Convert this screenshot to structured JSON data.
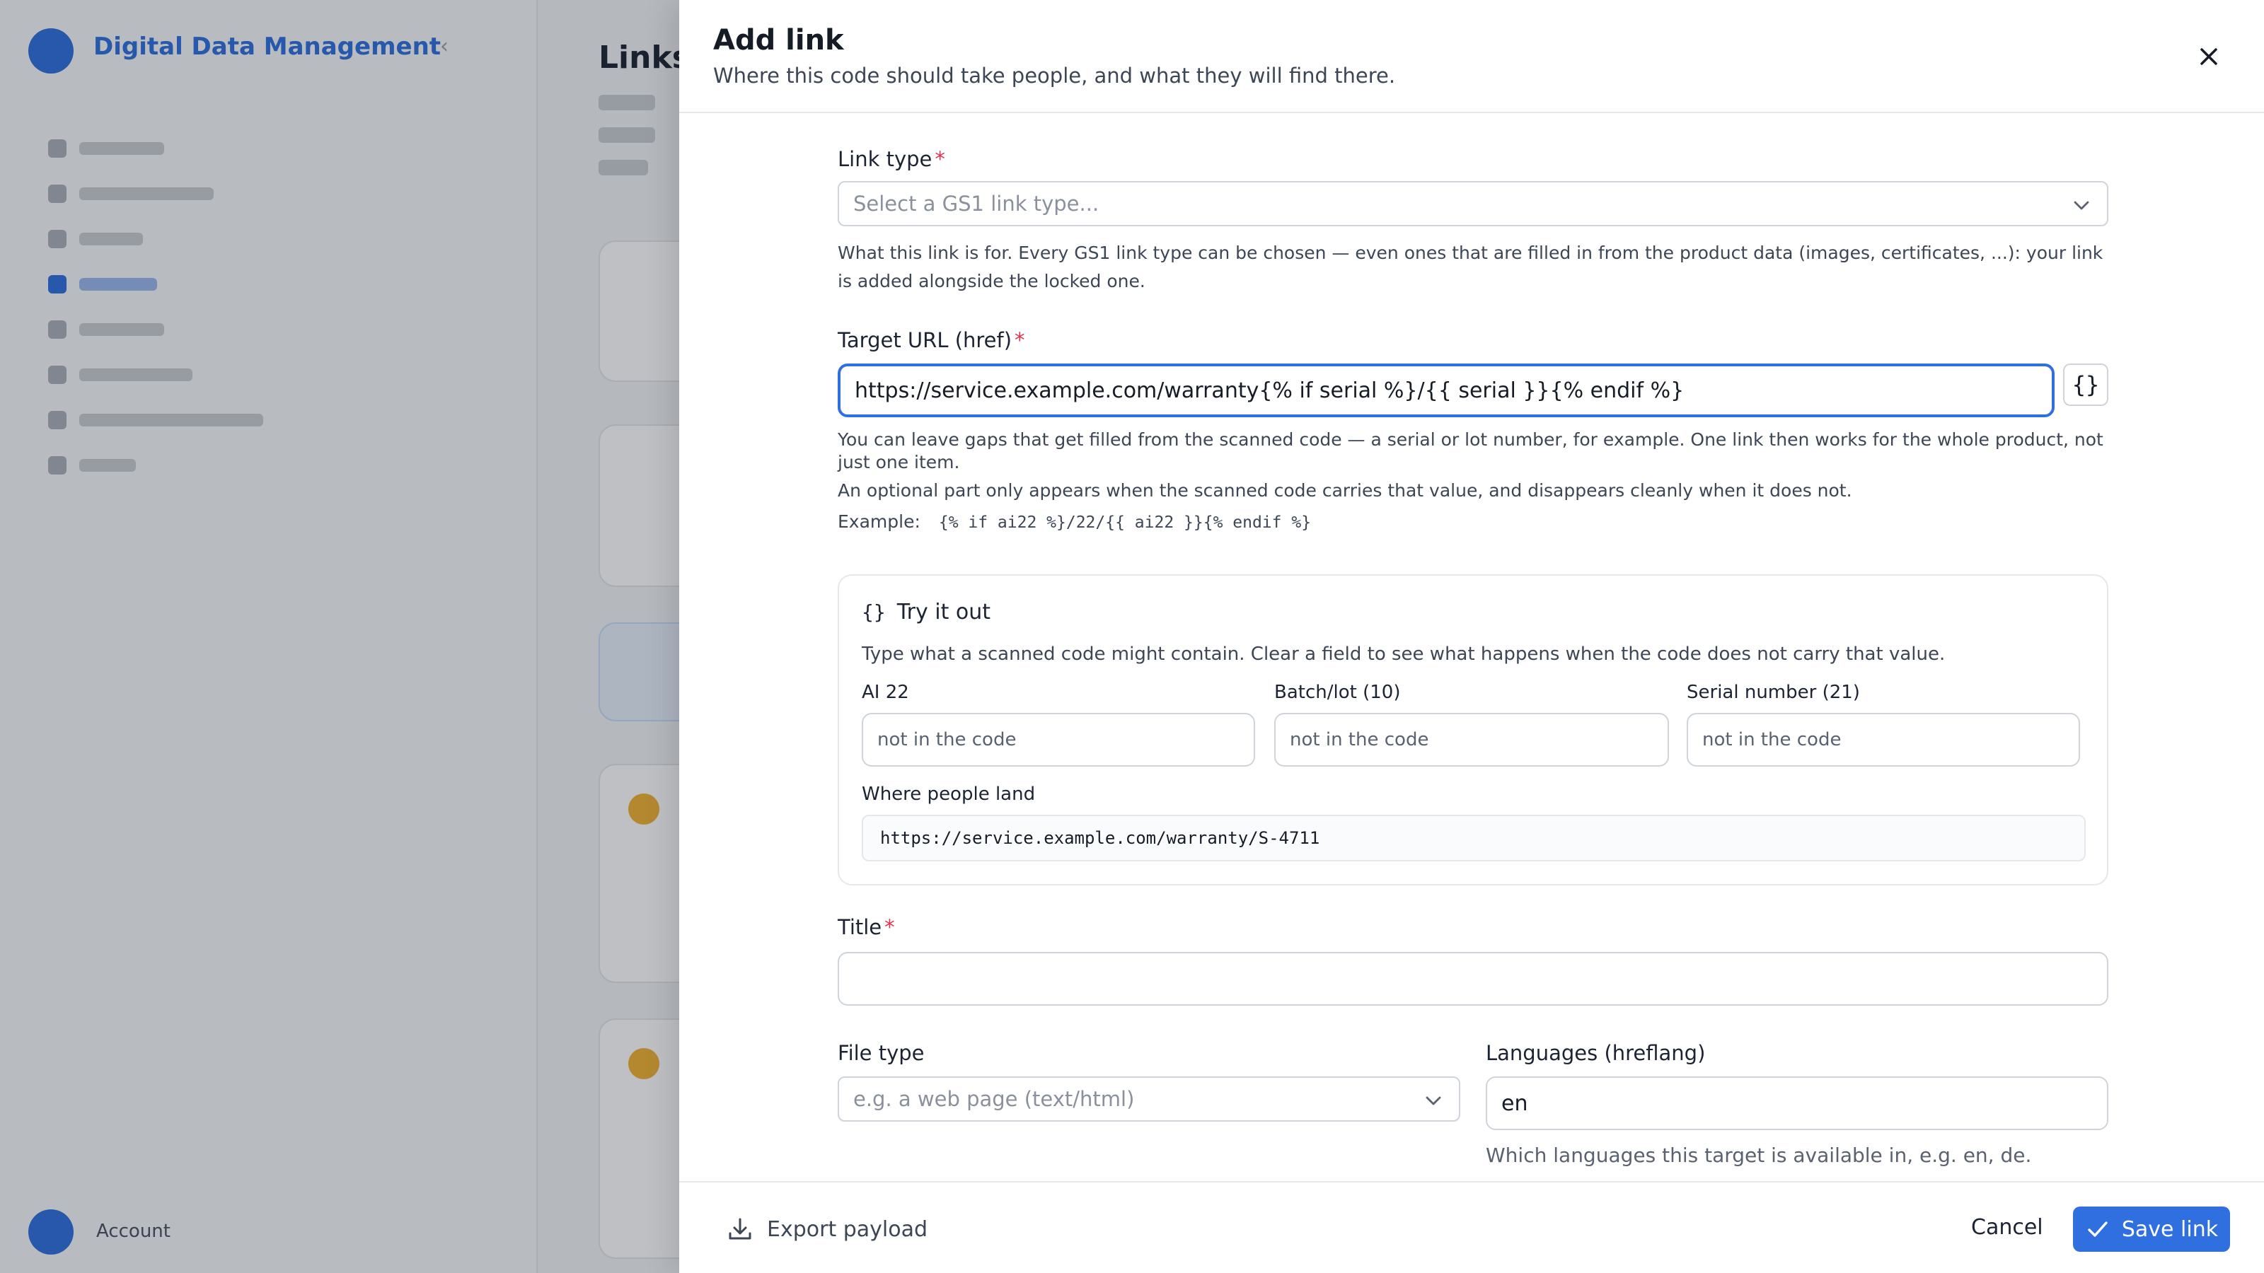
{
  "background": {
    "brand": "Digital Data Management",
    "page_title": "Links",
    "user_name": "Account"
  },
  "drawer": {
    "title": "Add link",
    "subtitle": "Where this code should take people, and what they will find there."
  },
  "form": {
    "link_type": {
      "label": "Link type",
      "required_mark": "*",
      "placeholder": "Select a GS1 link type...",
      "help": "What this link is for. Every GS1 link type can be chosen — even ones that are filled in from the product data (images, certificates, ...): your link is added alongside the locked one."
    },
    "target_url": {
      "label": "Target URL (href)",
      "required_mark": "*",
      "value": "https://service.example.com/warranty{% if serial %}/{{ serial }}{% endif %}",
      "braces_label": "{}",
      "help_1": "You can leave gaps that get filled from the scanned code — a serial or lot number, for example. One link then works for the whole product, not just one item.",
      "help_2": "An optional part only appears when the scanned code carries that value, and disappears cleanly when it does not.",
      "example_label": "Example:",
      "example_code": "{% if ai22 %}/22/{{ ai22 }}{% endif %}"
    },
    "try_it_out": {
      "icon_text": "{}",
      "heading": "Try it out",
      "description": "Type what a scanned code might contain. Clear a field to see what happens when the code does not carry that value.",
      "fields": [
        {
          "label": "AI 22",
          "placeholder": "not in the code"
        },
        {
          "label": "Batch/lot (10)",
          "placeholder": "not in the code"
        },
        {
          "label": "Serial number (21)",
          "placeholder": "not in the code"
        }
      ],
      "result_label": "Where people land",
      "result_value": "https://service.example.com/warranty/S-4711"
    },
    "title": {
      "label": "Title",
      "required_mark": "*",
      "value": ""
    },
    "file_type": {
      "label": "File type",
      "placeholder": "e.g. a web page (text/html)"
    },
    "languages": {
      "label": "Languages (hreflang)",
      "value": "en",
      "help": "Which languages this target is available in, e.g. en, de."
    }
  },
  "footer": {
    "export_label": "Export payload",
    "cancel_label": "Cancel",
    "save_label": "Save link"
  },
  "colors": {
    "accent": "#2f6fe0",
    "required": "#e0344d"
  }
}
